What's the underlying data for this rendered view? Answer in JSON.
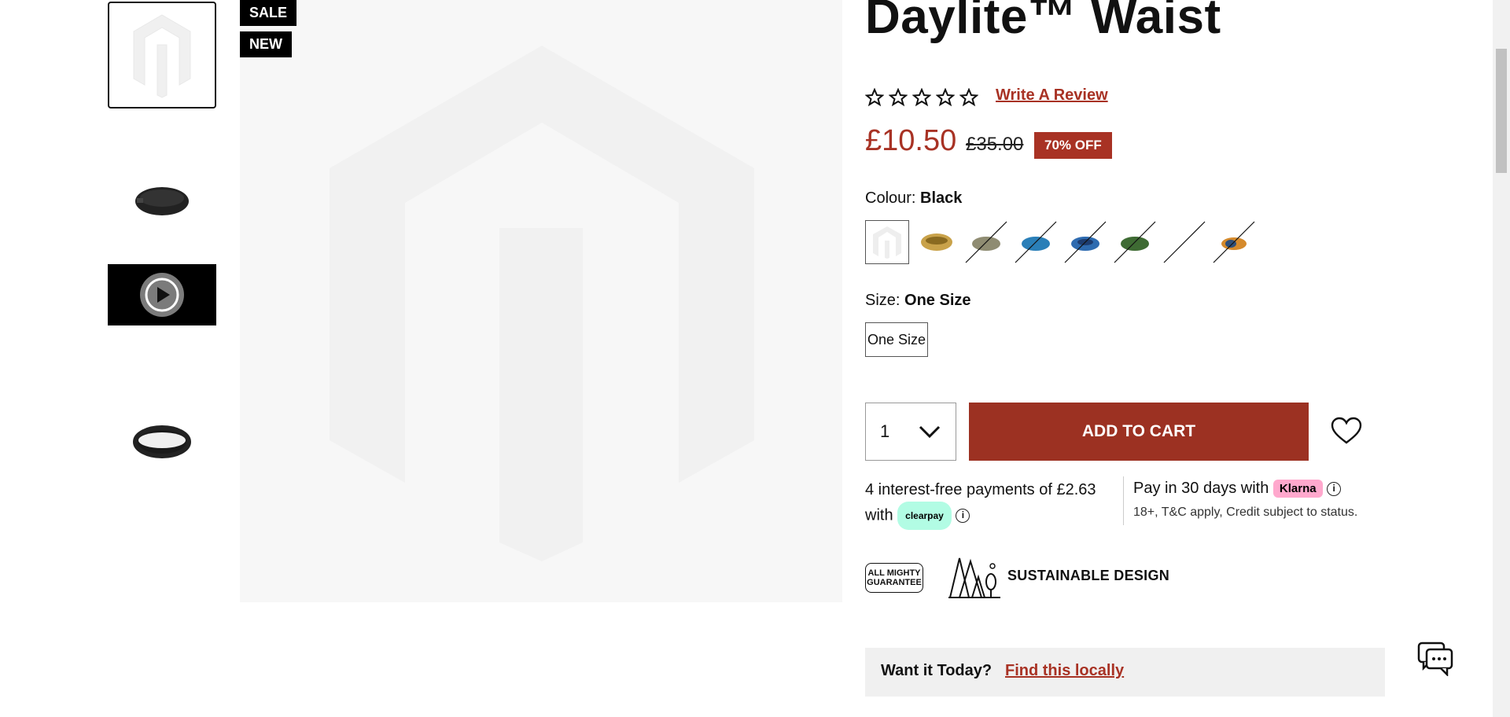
{
  "gallery": {
    "badges": [
      "SALE",
      "NEW"
    ],
    "thumbnails": [
      {
        "name": "placeholder-thumb",
        "kind": "placeholder"
      },
      {
        "name": "waist-pack-front-thumb",
        "kind": "product"
      },
      {
        "name": "video-thumb",
        "kind": "video"
      },
      {
        "name": "waist-pack-back-thumb",
        "kind": "product"
      }
    ]
  },
  "product": {
    "title": "Daylite™ Waist",
    "review_link": "Write A Review",
    "price_now": "£10.50",
    "price_was": "£35.00",
    "discount": "70% OFF",
    "colour_label": "Colour:",
    "colour_value": "Black",
    "size_label": "Size:",
    "size_value": "One Size",
    "size_option": "One Size",
    "quantity": "1",
    "add_to_cart": "ADD TO CART"
  },
  "payments": {
    "clearpay_text_1": "4 interest-free payments of £2.63",
    "clearpay_text_2": "with",
    "clearpay_badge": "clearpay",
    "klarna_text": "Pay in 30 days with",
    "klarna_badge": "Klarna",
    "klarna_small": "18+, T&C apply, Credit subject to status."
  },
  "features": {
    "guarantee_line1": "ALL MIGHTY",
    "guarantee_line2": "GUARANTEE",
    "sustainable": "SUSTAINABLE DESIGN"
  },
  "local": {
    "question": "Want it Today?",
    "link": "Find this locally"
  },
  "colors": {
    "accent": "#a83224",
    "button": "#9c3122",
    "swatches": [
      "placeholder",
      "#c9a24a",
      "#8f8c72",
      "#2a7fb8",
      "#2e6bb0",
      "#3e6b33",
      "none",
      "#d58a2c"
    ]
  }
}
